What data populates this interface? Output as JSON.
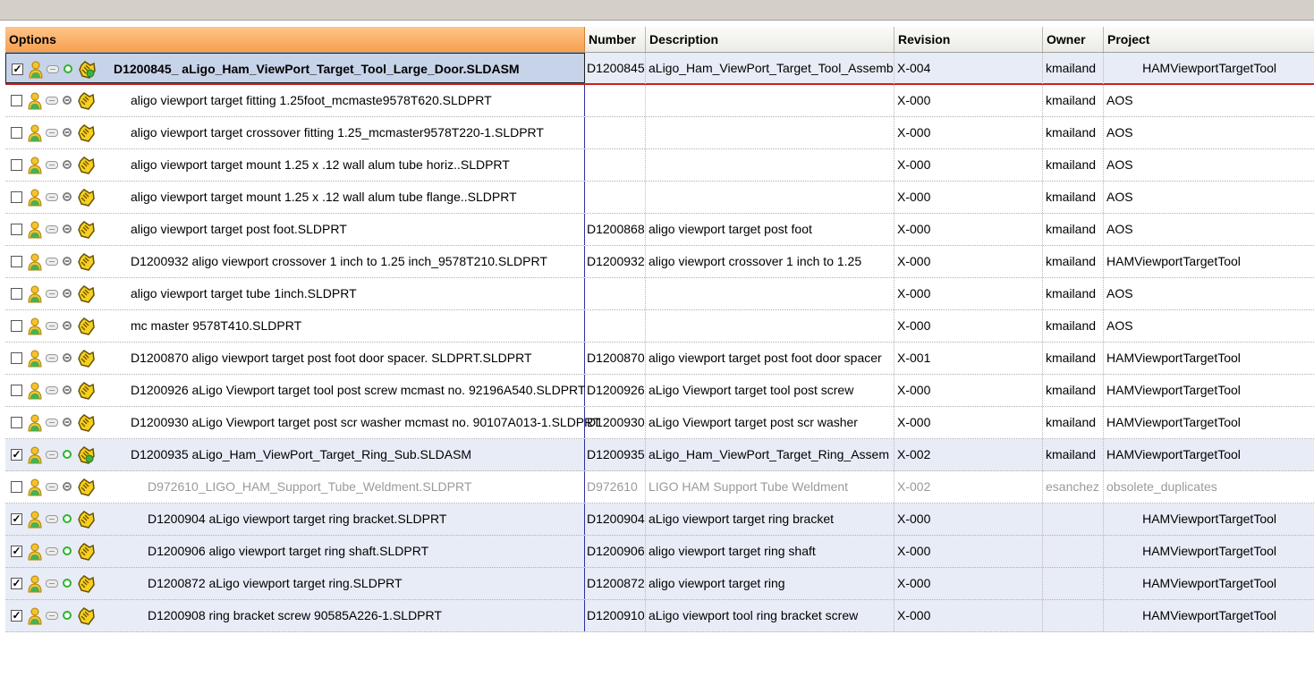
{
  "headers": {
    "options": "Options",
    "number": "Number",
    "description": "Description",
    "revision": "Revision",
    "owner": "Owner",
    "project": "Project"
  },
  "colors": {
    "options_header": "#f7a050",
    "selected_row": "#e8ecf6",
    "status_ok": "#2cb52c",
    "status_na": "#808080"
  },
  "rows": [
    {
      "checked": true,
      "status": "ok",
      "level": 0,
      "file": "D1200845_ aLigo_Ham_ViewPort_Target_Tool_Large_Door.SLDASM",
      "number": "D1200845",
      "description": "aLigo_Ham_ViewPort_Target_Tool_Assembly",
      "revision": "X-004",
      "owner": "kmailand",
      "project": "HAMViewportTargetTool",
      "icon": "hand-approved-icon"
    },
    {
      "checked": false,
      "status": "na",
      "level": 1,
      "file": "aligo viewport target fitting 1.25foot_mcmaste9578T620.SLDPRT",
      "number": "",
      "description": "",
      "revision": "X-000",
      "owner": "kmailand",
      "project": "AOS",
      "icon": "hand-icon"
    },
    {
      "checked": false,
      "status": "na",
      "level": 1,
      "file": "aligo viewport target crossover fitting 1.25_mcmaster9578T220-1.SLDPRT",
      "number": "",
      "description": "",
      "revision": "X-000",
      "owner": "kmailand",
      "project": "AOS",
      "icon": "hand-icon"
    },
    {
      "checked": false,
      "status": "na",
      "level": 1,
      "file": "aligo viewport target mount 1.25 x .12 wall alum tube horiz..SLDPRT",
      "number": "",
      "description": "",
      "revision": "X-000",
      "owner": "kmailand",
      "project": "AOS",
      "icon": "hand-icon"
    },
    {
      "checked": false,
      "status": "na",
      "level": 1,
      "file": "aligo viewport target mount 1.25 x .12 wall alum tube flange..SLDPRT",
      "number": "",
      "description": "",
      "revision": "X-000",
      "owner": "kmailand",
      "project": "AOS",
      "icon": "hand-icon"
    },
    {
      "checked": false,
      "status": "na",
      "level": 1,
      "file": "aligo viewport target post foot.SLDPRT",
      "number": "D1200868",
      "description": "aligo viewport target post foot",
      "revision": "X-000",
      "owner": "kmailand",
      "project": "AOS",
      "icon": "hand-icon"
    },
    {
      "checked": false,
      "status": "na",
      "level": 1,
      "file": "D1200932 aligo viewport crossover 1 inch to 1.25 inch_9578T210.SLDPRT",
      "number": "D1200932",
      "description": "aligo viewport crossover 1 inch to 1.25",
      "revision": "X-000",
      "owner": "kmailand",
      "project": "HAMViewportTargetTool",
      "icon": "hand-icon"
    },
    {
      "checked": false,
      "status": "na",
      "level": 1,
      "file": "aligo viewport target tube 1inch.SLDPRT",
      "number": "",
      "description": "",
      "revision": "X-000",
      "owner": "kmailand",
      "project": "AOS",
      "icon": "hand-icon"
    },
    {
      "checked": false,
      "status": "na",
      "level": 1,
      "file": "mc master 9578T410.SLDPRT",
      "number": "",
      "description": "",
      "revision": "X-000",
      "owner": "kmailand",
      "project": "AOS",
      "icon": "hand-icon"
    },
    {
      "checked": false,
      "status": "na",
      "level": 1,
      "file": "D1200870 aligo viewport target post foot door spacer. SLDPRT.SLDPRT",
      "number": "D1200870",
      "description": "aligo viewport target post foot door spacer",
      "revision": "X-001",
      "owner": "kmailand",
      "project": "HAMViewportTargetTool",
      "icon": "hand-icon"
    },
    {
      "checked": false,
      "status": "na",
      "level": 1,
      "file": "D1200926 aLigo Viewport target tool post screw mcmast no.  92196A540.SLDPRT",
      "number": "D1200926",
      "description": "aLigo Viewport target tool post screw",
      "revision": "X-000",
      "owner": "kmailand",
      "project": "HAMViewportTargetTool",
      "icon": "hand-icon"
    },
    {
      "checked": false,
      "status": "na",
      "level": 1,
      "file": "D1200930 aLigo Viewport target post scr washer mcmast no. 90107A013-1.SLDPRT",
      "number": "D1200930",
      "description": "aLigo Viewport target post scr washer",
      "revision": "X-000",
      "owner": "kmailand",
      "project": "HAMViewportTargetTool",
      "icon": "hand-icon"
    },
    {
      "checked": true,
      "status": "ok",
      "level": 1,
      "file": "D1200935 aLigo_Ham_ViewPort_Target_Ring_Sub.SLDASM",
      "number": "D1200935",
      "description": "aLigo_Ham_ViewPort_Target_Ring_Assem",
      "revision": "X-002",
      "owner": "kmailand",
      "project": "HAMViewportTargetTool",
      "icon": "hand-approved-icon"
    },
    {
      "checked": false,
      "status": "na",
      "level": 2,
      "gray": true,
      "file": "D972610_LIGO_HAM_Support_Tube_Weldment.SLDPRT",
      "number": "D972610",
      "description": "LIGO HAM Support Tube Weldment",
      "revision": "X-002",
      "owner": "esanchez",
      "project": "obsolete_duplicates",
      "icon": "hand-icon"
    },
    {
      "checked": true,
      "status": "ok",
      "level": 2,
      "file": "D1200904 aLigo viewport target ring bracket.SLDPRT",
      "number": "D1200904",
      "description": "aLigo viewport target ring bracket",
      "revision": "X-000",
      "owner": "",
      "project": "HAMViewportTargetTool",
      "icon": "hand-icon"
    },
    {
      "checked": true,
      "status": "ok",
      "level": 2,
      "file": "D1200906 aligo viewport target ring shaft.SLDPRT",
      "number": "D1200906",
      "description": "aligo viewport target ring shaft",
      "revision": "X-000",
      "owner": "",
      "project": "HAMViewportTargetTool",
      "icon": "hand-icon"
    },
    {
      "checked": true,
      "status": "ok",
      "level": 2,
      "file": "D1200872 aLigo viewport target ring.SLDPRT",
      "number": "D1200872",
      "description": "aligo viewport target ring",
      "revision": "X-000",
      "owner": "",
      "project": "HAMViewportTargetTool",
      "icon": "hand-icon"
    },
    {
      "checked": true,
      "status": "ok",
      "level": 2,
      "file": "D1200908 ring bracket screw 90585A226-1.SLDPRT",
      "number": "D1200910",
      "description": "aLigo viewport tool ring bracket screw",
      "revision": "X-000",
      "owner": "",
      "project": "HAMViewportTargetTool",
      "icon": "hand-icon"
    }
  ]
}
